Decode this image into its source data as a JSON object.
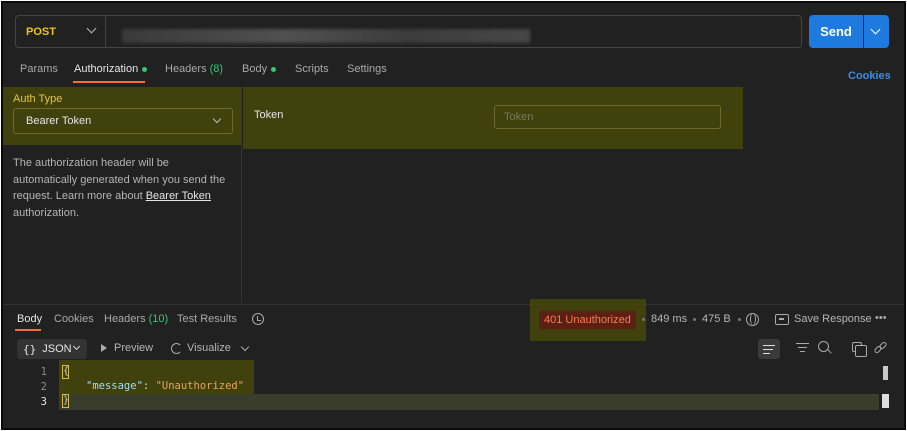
{
  "request": {
    "method": "POST",
    "send_label": "Send",
    "tabs": [
      {
        "label": "Params"
      },
      {
        "label": "Authorization"
      },
      {
        "label": "Headers",
        "count": "(8)"
      },
      {
        "label": "Body"
      },
      {
        "label": "Scripts"
      },
      {
        "label": "Settings"
      }
    ],
    "cookies_label": "Cookies"
  },
  "auth": {
    "type_label": "Auth Type",
    "selected": "Bearer Token",
    "description_1": "The authorization header will be automatically generated when you send the request. Learn more about",
    "description_link": "Bearer Token",
    "description_2": "authorization.",
    "token_label": "Token",
    "token_placeholder": "Token"
  },
  "response": {
    "tabs": [
      {
        "label": "Body"
      },
      {
        "label": "Cookies"
      },
      {
        "label": "Headers",
        "count": "(10)"
      },
      {
        "label": "Test Results"
      }
    ],
    "status": "401 Unauthorized",
    "time": "849 ms",
    "size": "475 B",
    "save_label": "Save Response",
    "format": "JSON",
    "preview_label": "Preview",
    "visualize_label": "Visualize",
    "line_numbers": [
      "1",
      "2",
      "3"
    ],
    "open_brace": "{",
    "close_brace": "}",
    "key": "\"message\"",
    "colon": ": ",
    "value": "\"Unauthorized\""
  },
  "colors": {
    "accent": "#ff6c37",
    "send": "#1f7ae0",
    "method": "#f1c40f",
    "status_error": "#ff7a4d",
    "active_dot": "#2ecc71"
  }
}
